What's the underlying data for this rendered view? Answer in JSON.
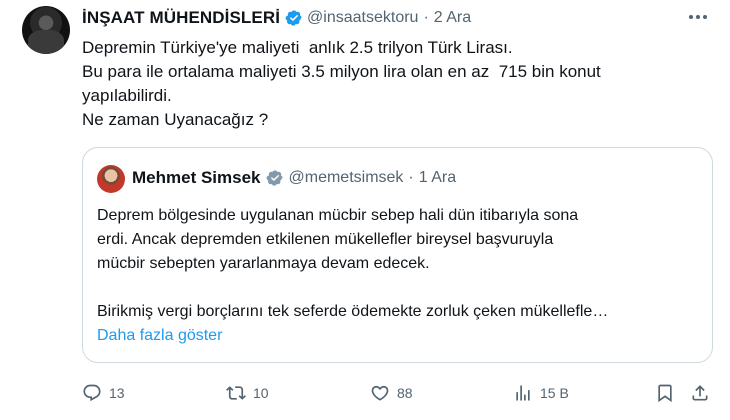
{
  "tweet": {
    "author_name": "İNŞAAT MÜHENDİSLERİ",
    "handle": "@insaatsektoru",
    "dot": "·",
    "date": "2 Ara",
    "lines": [
      "Depremin Türkiye'ye maliyeti  anlık 2.5 trilyon Türk Lirası.",
      "Bu para ile ortalama maliyeti 3.5 milyon lira olan en az  715 bin konut",
      "yapılabilirdi.",
      "Ne zaman Uyanacağız ?"
    ]
  },
  "quote": {
    "author_name": "Mehmet Simsek",
    "handle": "@memetsimsek",
    "dot": "·",
    "date": "1 Ara",
    "lines": [
      "Deprem bölgesinde uygulanan mücbir sebep hali dün itibarıyla sona",
      "erdi. Ancak depremden etkilenen mükellefler bireysel başvuruyla",
      "mücbir sebepten yararlanmaya devam edecek.",
      "Birikmiş vergi borçlarını tek seferde ödemekte zorluk çeken mükellefle…"
    ],
    "show_more": "Daha fazla göster"
  },
  "actions": {
    "replies": "13",
    "retweets": "10",
    "likes": "88",
    "views": "15 B"
  },
  "colors": {
    "text": "#0f1419",
    "muted": "#536471",
    "accent": "#1d9bf0",
    "border": "#cfd9de"
  },
  "icons": {
    "verified": "verified-badge-icon",
    "more": "more-horizontal-icon",
    "reply": "reply-icon",
    "retweet": "retweet-icon",
    "like": "heart-icon",
    "views": "views-icon",
    "bookmark": "bookmark-icon",
    "share": "share-icon"
  }
}
